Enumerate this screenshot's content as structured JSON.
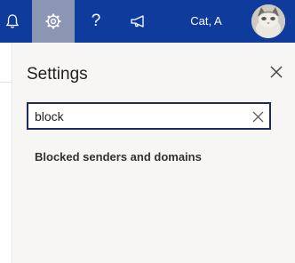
{
  "header": {
    "user_name": "Cat, A",
    "icons": {
      "bell": "bell-icon",
      "settings": "gear-icon",
      "help": "?",
      "feedback": "megaphone-icon"
    }
  },
  "settings_panel": {
    "title": "Settings",
    "search": {
      "value": "block"
    },
    "results": [
      {
        "label": "Blocked senders and domains"
      }
    ]
  },
  "colors": {
    "header_bg": "#0f3b9d",
    "active_button_bg": "#8a96b3",
    "panel_bg": "#f7f6f5",
    "search_border": "#1c2b5a"
  }
}
